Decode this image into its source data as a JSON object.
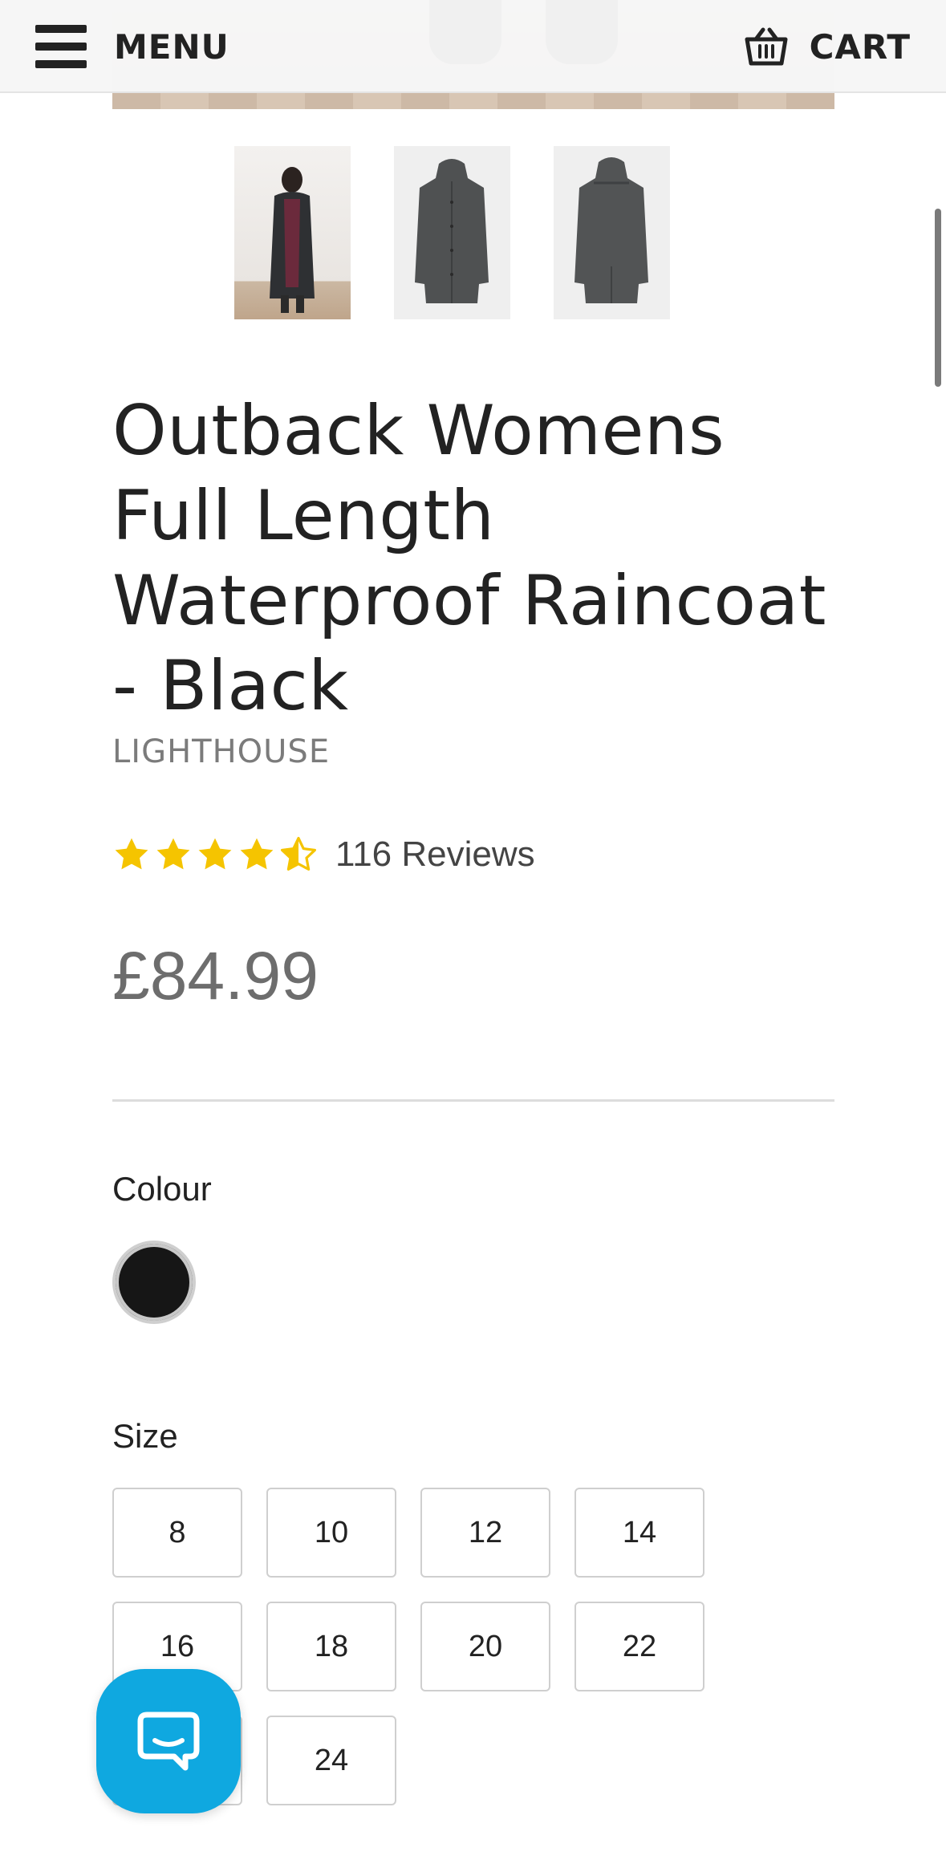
{
  "header": {
    "menu_label": "MENU",
    "cart_label": "CART"
  },
  "product": {
    "title": "Outback Womens Full Length Waterproof Raincoat - Black",
    "brand": "LIGHTHOUSE",
    "rating": 4.5,
    "rating_max": 5,
    "reviews_text": "116 Reviews",
    "price": "£84.99"
  },
  "thumbnails": [
    {
      "name": "model-wearing-coat"
    },
    {
      "name": "coat-front-view"
    },
    {
      "name": "coat-back-view"
    }
  ],
  "colour": {
    "label": "Colour",
    "options": [
      {
        "value": "black",
        "hex": "#161616"
      }
    ]
  },
  "size": {
    "label": "Size",
    "options": [
      "8",
      "10",
      "12",
      "14",
      "16",
      "18",
      "20",
      "22",
      "",
      "24"
    ]
  },
  "colors": {
    "star": "#f5c400",
    "chat": "#0fa8e0",
    "text": "#222222",
    "muted": "#6d6d6d"
  }
}
